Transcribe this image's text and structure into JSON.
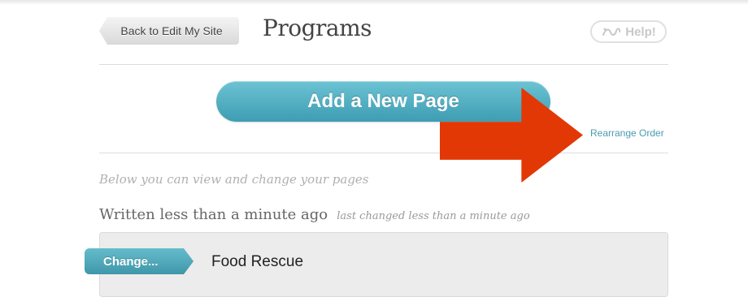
{
  "header": {
    "back_label": "Back to Edit My Site",
    "title": "Programs",
    "help_label": "Help!"
  },
  "actions": {
    "add_page_label": "Add a New Page",
    "rearrange_label": "Rearrange Order"
  },
  "pages_section": {
    "intro": "Below you can view and change your pages",
    "written": "Written less than a minute ago",
    "last_changed": "last changed less than a minute ago",
    "items": [
      {
        "change_label": "Change...",
        "name": "Food Rescue"
      }
    ]
  },
  "colors": {
    "accent": "#4a9bb0",
    "arrow": "#e23806"
  },
  "icons": {
    "help": "help-squiggle-icon",
    "arrow": "arrow-right-icon"
  }
}
